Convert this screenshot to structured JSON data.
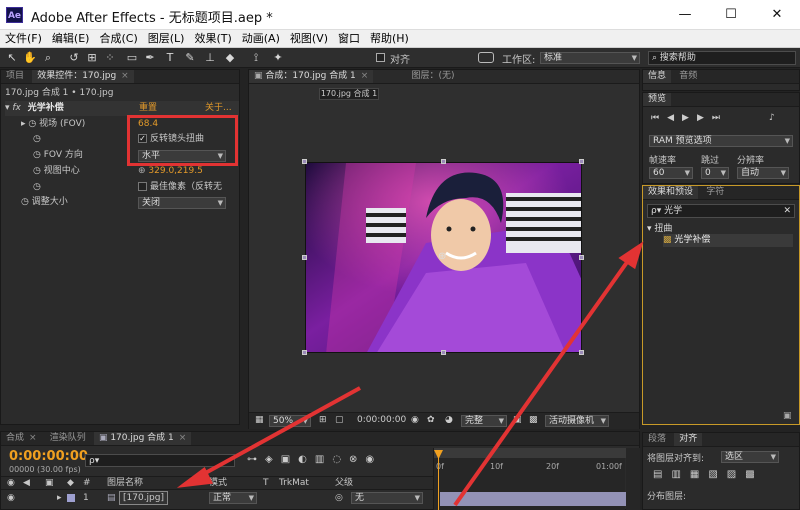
{
  "window": {
    "logo": "Ae",
    "title": "Adobe After Effects - 无标题项目.aep *",
    "minimize": "—",
    "maximize": "☐",
    "close": "✕"
  },
  "menu": [
    "文件(F)",
    "编辑(E)",
    "合成(C)",
    "图层(L)",
    "效果(T)",
    "动画(A)",
    "视图(V)",
    "窗口",
    "帮助(H)"
  ],
  "toolbar": {
    "align_label": "对齐",
    "workspace_label": "工作区:",
    "workspace_value": "标准",
    "search_placeholder": "搜索帮助"
  },
  "left_panel": {
    "tab_project": "项目",
    "tab_effects_controls": "效果控件：170.jpg",
    "breadcrumb": "170.jpg 合成 1 • 170.jpg",
    "effect": {
      "fx": "fx",
      "name": "光学补偿",
      "reset": "重置",
      "about": "关于...",
      "fov_label": "视场 (FOV)",
      "fov_value": "68.4",
      "reverse_label": "反转镜头扭曲",
      "reverse_checked": "✓",
      "fov_dir_label": "FOV 方向",
      "fov_dir_value": "水平",
      "center_label": "视图中心",
      "center_value": "329.0,219.5",
      "optimal_label": "最佳像素（反转无",
      "resize_label": "调整大小",
      "resize_value": "关闭"
    }
  },
  "comp_panel": {
    "tab_comp": "合成：170.jpg 合成 1",
    "tab_layer": "图层：(无)",
    "comp_chip": "170.jpg 合成 1",
    "zoom": "50%",
    "timecode": "0:00:00:00",
    "quality": "完整",
    "camera": "活动摄像机"
  },
  "right_panel": {
    "tab_info": "信息",
    "tab_audio": "音频",
    "tab_preview": "预览",
    "ram_preview": "RAM 预览选项",
    "frame_rate_label": "帧速率",
    "skip_label": "跳过",
    "resolution_label": "分辨率",
    "frame_rate_value": "60",
    "skip_value": "0",
    "resolution_value": "自动",
    "tab_effects_presets": "效果和预设",
    "tab_characters": "字符",
    "search_value": "光学",
    "category": "扭曲",
    "result": "光学补偿",
    "tab_paragraph": "段落",
    "tab_align": "对齐",
    "align_to_label": "将图层对齐到:",
    "align_to_value": "选区",
    "distribute_label": "分布图层:"
  },
  "timeline": {
    "tab_comp": "合成",
    "tab_render_queue": "渲染队列",
    "tab_comp_active": "170.jpg 合成 1",
    "timecode": "0:00:00:00",
    "fps": "00000 (30.00 fps)",
    "search_placeholder": "ρ▾",
    "col_source_name": "图层名称",
    "col_mode": "模式",
    "col_t": "T",
    "col_trkmat": "TrkMat",
    "col_parent": "父级",
    "layer_index": "1",
    "layer_name": "[170.jpg]",
    "layer_mode": "正常",
    "parent_value": "无",
    "ticks": [
      "0f",
      "10f",
      "20f",
      "01:00f"
    ]
  },
  "colors": {
    "accent_orange": "#e39a2a",
    "highlight_red": "#e23333",
    "timeline_orange": "#f0a020"
  }
}
